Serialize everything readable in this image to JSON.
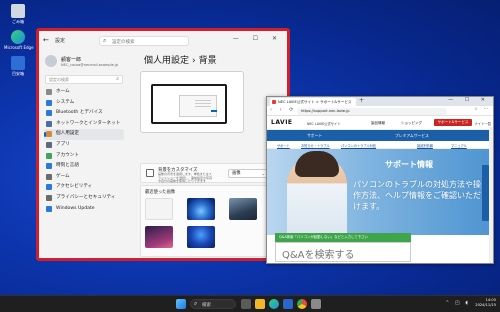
{
  "colors": {
    "highlight_frame": "#d21f2b",
    "desktop": "#0d36b0",
    "brand_red": "#c9261f",
    "subnav_blue": "#1b5fa8",
    "accent": "#0067c0"
  },
  "desktop_icons": [
    {
      "label": "ごみ箱",
      "icon": "recycle-bin-icon"
    },
    {
      "label": "Microsoft Edge",
      "icon": "edge-icon"
    },
    {
      "label": "目安箱",
      "icon": "app-shortcut-icon"
    }
  ],
  "settings": {
    "app_title": "設定",
    "search_placeholder": "設定の検索",
    "window_controls": "—  ☐  ✕",
    "user_name": "顧客一郎",
    "user_email": "NEC_cocoa@necmail.example.jp",
    "find_placeholder": "設定の検索",
    "nav": [
      {
        "label": "ホーム",
        "icon": "home-icon",
        "color": "#8a8a8a"
      },
      {
        "label": "システム",
        "icon": "system-icon",
        "color": "#2b7bd6"
      },
      {
        "label": "Bluetooth とデバイス",
        "icon": "bluetooth-icon",
        "color": "#2b7bd6"
      },
      {
        "label": "ネットワークとインターネット",
        "icon": "network-icon",
        "color": "#4a6fa5"
      },
      {
        "label": "個人用設定",
        "icon": "personalization-icon",
        "color": "#d48a3b"
      },
      {
        "label": "アプリ",
        "icon": "apps-icon",
        "color": "#5c6b7a"
      },
      {
        "label": "アカウント",
        "icon": "account-icon",
        "color": "#3ea45f"
      },
      {
        "label": "時刻と言語",
        "icon": "time-language-icon",
        "color": "#2b7bd6"
      },
      {
        "label": "ゲーム",
        "icon": "gaming-icon",
        "color": "#6b6b6b"
      },
      {
        "label": "アクセシビリティ",
        "icon": "accessibility-icon",
        "color": "#2b7bd6"
      },
      {
        "label": "プライバシーとセキュリティ",
        "icon": "privacy-icon",
        "color": "#6b6b6b"
      },
      {
        "label": "Windows Update",
        "icon": "windows-update-icon",
        "color": "#2b7bd6"
      }
    ],
    "active_nav_index": 4,
    "breadcrumb_parent": "個人用設定",
    "breadcrumb_sep": "›",
    "breadcrumb_current": "背景",
    "background_card": {
      "title": "背景をカスタマイズ",
      "description": "画像の背景を適用します。単色またはスライドショーを選択し、事前設定の写真や自分の画像を使用したりできます",
      "dropdown_value": "画像"
    },
    "recent_images_label": "最近使った画像"
  },
  "browser": {
    "tab_title": "NEC LAVIE公式サイト > サポート&サービス",
    "new_tab": "+",
    "window_controls": "—  ☐  ✕",
    "nav_buttons": "‹  ›  ⟳",
    "url": "https://support.nec-lavie.jp",
    "toolbar_icons": "☆  ⋯",
    "site_logo": "LAVIE",
    "site_name": "NEC LAVIE公式サイト",
    "menu": [
      "製品情報",
      "ショッピング"
    ],
    "support_button": "サポート&サービス",
    "menu_more": "ナイト一覧",
    "subnav": [
      "サポート",
      "プレミアムサービス"
    ],
    "links": [
      "サポート",
      "お知らせ・トラブル",
      "パソコンのトラブル対処",
      "製品別情報",
      "マニュアル"
    ],
    "hero_title": "サポート情報",
    "hero_subtitle": "パソコンのトラブルの対処方法や操作方法、ヘルプ情報をご確認いただけます。",
    "qa_chip": "Q&A検索「パソコンが起動しない」などと入力して下さい",
    "qa_placeholder": "Q&Aを検索する"
  },
  "taskbar": {
    "search_text": "検索",
    "search_icon": "search-icon",
    "apps": [
      {
        "icon": "start-icon",
        "color": "#3aa0f0"
      },
      {
        "icon": "task-view-icon",
        "color": "#5a5a5a"
      },
      {
        "icon": "file-explorer-icon",
        "color": "#f1b727"
      },
      {
        "icon": "edge-icon",
        "color": "#1fa0c6"
      },
      {
        "icon": "store-icon",
        "color": "#2a66c9"
      },
      {
        "icon": "chrome-icon",
        "color": "#e94b3c"
      },
      {
        "icon": "settings-icon",
        "color": "#8a8a8a"
      }
    ],
    "tray_glyphs": "⌃  ◰  ◖",
    "time": "14:05",
    "date": "2024/11/15"
  }
}
